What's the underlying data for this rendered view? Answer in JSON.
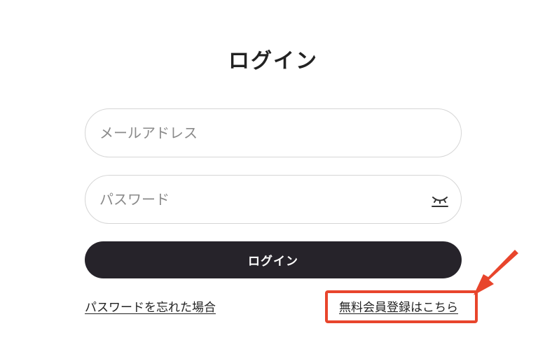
{
  "header": {
    "title": "ログイン"
  },
  "form": {
    "email_placeholder": "メールアドレス",
    "password_placeholder": "パスワード",
    "password_toggle_icon": "eye-closed-icon",
    "login_button_label": "ログイン"
  },
  "links": {
    "forgot_password": "パスワードを忘れた場合",
    "register": "無料会員登録はこちら"
  },
  "annotation": {
    "highlight_color": "#e8452c"
  },
  "colors": {
    "button_background": "#26232a",
    "button_text": "#ffffff",
    "field_border": "#d6d6d6",
    "text": "#222222"
  }
}
